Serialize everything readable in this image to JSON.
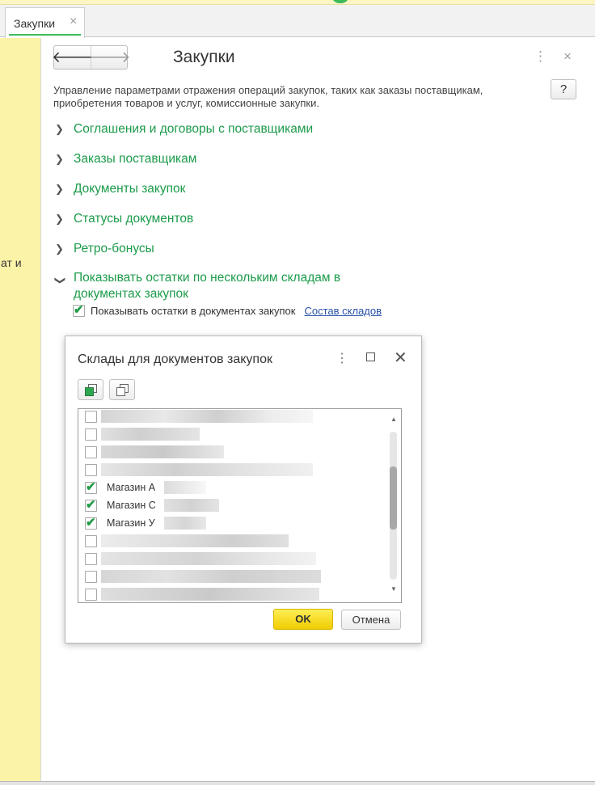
{
  "window": {
    "tab_label": "Закупки",
    "tab_close_glyph": "×",
    "left_panel_text": "ат и"
  },
  "form": {
    "back_glyph": "🡐",
    "forward_glyph": "🡒",
    "title": "Закупки",
    "more_glyph": "⋮",
    "close_glyph": "×",
    "description": "Управление параметрами отражения операций закупок, таких как заказы поставщикам, приобретения товаров и услуг, комиссионные закупки.",
    "help_label": "?",
    "sections": [
      {
        "label": "Соглашения и договоры с поставщиками",
        "expanded": false
      },
      {
        "label": "Заказы поставщикам",
        "expanded": false
      },
      {
        "label": "Документы закупок",
        "expanded": false
      },
      {
        "label": "Статусы документов",
        "expanded": false
      },
      {
        "label": "Ретро-бонусы",
        "expanded": false
      },
      {
        "label": "Показывать остатки по нескольким складам в документах закупок",
        "expanded": true
      }
    ],
    "show_balances": {
      "checked": true,
      "label": "Показывать остатки в документах закупок",
      "link": "Состав складов"
    }
  },
  "dialog": {
    "title": "Склады для документов закупок",
    "more_glyph": "⋮",
    "close_glyph": "✕",
    "check_all_icon": "check-all-icon",
    "uncheck_all_icon": "uncheck-all-icon",
    "items": [
      {
        "checked": false,
        "name": ""
      },
      {
        "checked": false,
        "name": ""
      },
      {
        "checked": false,
        "name": ""
      },
      {
        "checked": false,
        "name": ""
      },
      {
        "checked": true,
        "name": "Магазин А"
      },
      {
        "checked": true,
        "name": "Магазин С"
      },
      {
        "checked": true,
        "name": "Магазин У"
      },
      {
        "checked": false,
        "name": ""
      },
      {
        "checked": false,
        "name": ""
      },
      {
        "checked": false,
        "name": ""
      },
      {
        "checked": false,
        "name": ""
      }
    ],
    "ok_label": "OK",
    "cancel_label": "Отмена"
  },
  "colors": {
    "accent_green": "#1b9b4a",
    "link_blue": "#2851a8",
    "ok_yellow": "#f5d800",
    "side_panel_yellow": "#fbf3a8"
  }
}
